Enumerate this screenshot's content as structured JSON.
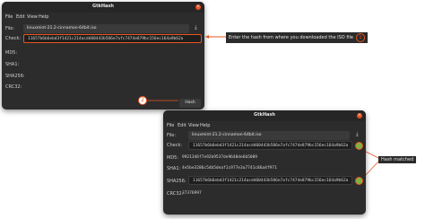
{
  "window1": {
    "title": "GtkHash",
    "menu": [
      "File",
      "Edit",
      "View",
      "Help"
    ],
    "file_label": "File:",
    "file_name": "linuxmint-21.2-cinnamon-64bit.iso",
    "check_label": "Check:",
    "check_value": "11657b6b6ebd3f1421c214acdd60443b586e7afc7474e879bc156ec164a9b62a",
    "labels": [
      "MD5:",
      "SHA1:",
      "SHA256:",
      "CRC32:"
    ],
    "hash_button": "Hash"
  },
  "window2": {
    "title": "GtkHash",
    "menu": [
      "File",
      "Edit",
      "View",
      "Help"
    ],
    "file_label": "File:",
    "file_name": "linuxmint-21.2-cinnamon-64bit.iso",
    "check_label": "Check:",
    "check_value": "11657b6b6ebd3f1421c214acdd60443b586e7afc7474e879bc156ec164a9b62a",
    "md5_label": "MD5:",
    "md5_value": "9921346f7e92b9537de9640de6b5089",
    "sha1_label": "SHA1:",
    "sha1_value": "4e5be3286c5db5deaf1c977e3a7741c86a4f971",
    "sha256_label": "SHA256:",
    "sha256_value": "11657b6b6ebd3f1421c214acdd60443b586e7afc7474e879bc156ec164a9b62a",
    "crc_label": "CRC32:",
    "crc_value": "37376997"
  },
  "annotations": {
    "step1_text": "Enter the hash from where you downloaded the ISO file",
    "step1_num": "1",
    "step2_num": "2",
    "match_text": "Hash matched"
  },
  "colors": {
    "accent": "#e95420",
    "match_dot": "#7cb342"
  }
}
